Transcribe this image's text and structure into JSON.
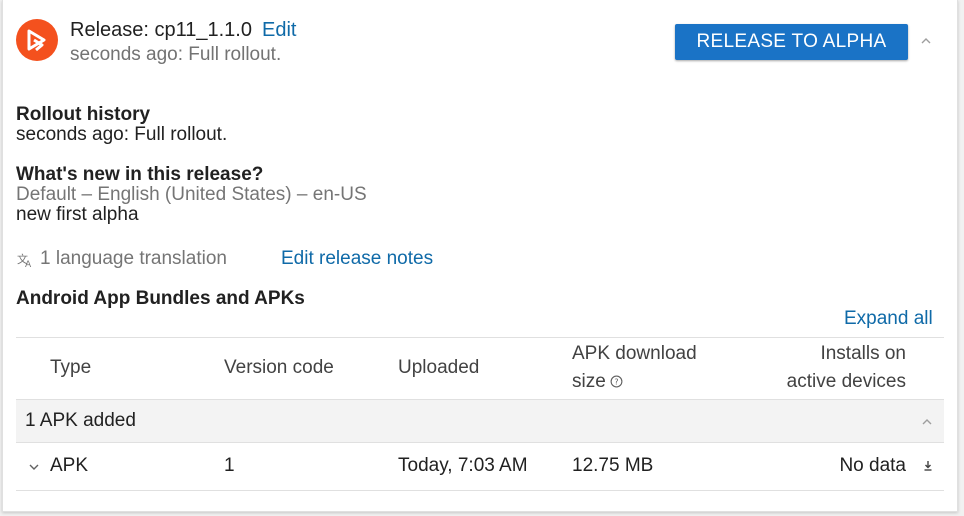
{
  "release": {
    "title": "Release: cp11_1.1.0",
    "edit_label": "Edit",
    "subtitle": "seconds ago: Full rollout.",
    "action_button": "RELEASE TO ALPHA"
  },
  "rollout": {
    "heading": "Rollout history",
    "text": "seconds ago: Full rollout."
  },
  "whats_new": {
    "heading": "What's new in this release?",
    "locale": "Default – English (United States) – en-US",
    "notes": "new first alpha"
  },
  "translations": {
    "count_text": "1 language translation",
    "edit_notes_label": "Edit release notes"
  },
  "bundles": {
    "heading": "Android App Bundles and APKs",
    "expand_all_label": "Expand all",
    "columns": {
      "type": "Type",
      "version_code": "Version code",
      "uploaded": "Uploaded",
      "apk_size_line1": "APK download",
      "apk_size_line2": "size",
      "installs_line1": "Installs on",
      "installs_line2": "active devices"
    },
    "group_label": "1 APK added",
    "rows": [
      {
        "type": "APK",
        "version_code": "1",
        "uploaded": "Today, 7:03 AM",
        "size": "12.75 MB",
        "installs": "No data"
      }
    ]
  },
  "colors": {
    "accent": "#1a73c6",
    "link": "#0f6aa8",
    "app_icon": "#f4511e"
  },
  "icons": [
    "play-release-icon",
    "chevron-up-icon",
    "translate-icon",
    "help-circle-icon",
    "chevron-down-icon",
    "download-icon"
  ]
}
